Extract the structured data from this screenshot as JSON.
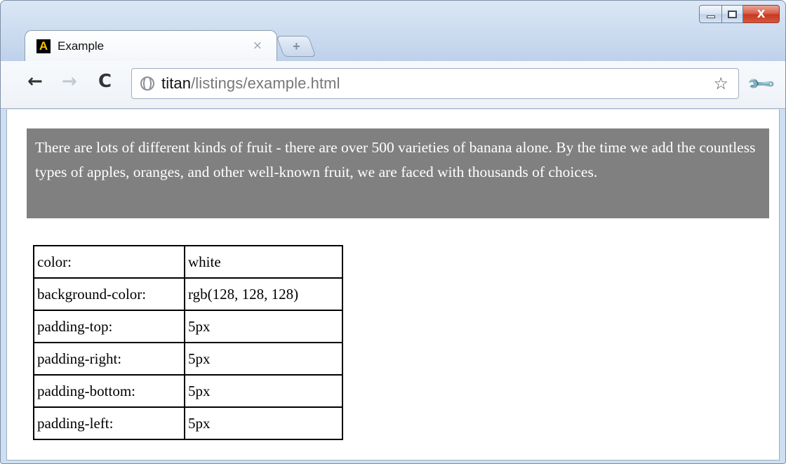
{
  "window": {
    "tab_favicon_letter": "A",
    "tab_title": "Example",
    "tab_close": "×",
    "new_tab_glyph": "+",
    "minimize_label": "",
    "maximize_label": "",
    "close_label": "X"
  },
  "toolbar": {
    "back_glyph": "←",
    "forward_glyph": "→",
    "reload_glyph": "C",
    "url_host": "titan",
    "url_path": "/listings/example.html",
    "star_glyph": "☆",
    "wrench_glyph": "🔧"
  },
  "content": {
    "paragraph": "There are lots of different kinds of fruit - there are over 500 varieties of banana alone. By the time we add the countless types of apples, oranges, and other well-known fruit, we are faced with thousands of choices.",
    "paragraph_bg": "#808080",
    "properties": [
      {
        "name": "color:",
        "value": "white"
      },
      {
        "name": "background-color:",
        "value": "rgb(128, 128, 128)"
      },
      {
        "name": "padding-top:",
        "value": "5px"
      },
      {
        "name": "padding-right:",
        "value": "5px"
      },
      {
        "name": "padding-bottom:",
        "value": "5px"
      },
      {
        "name": "padding-left:",
        "value": "5px"
      }
    ]
  }
}
